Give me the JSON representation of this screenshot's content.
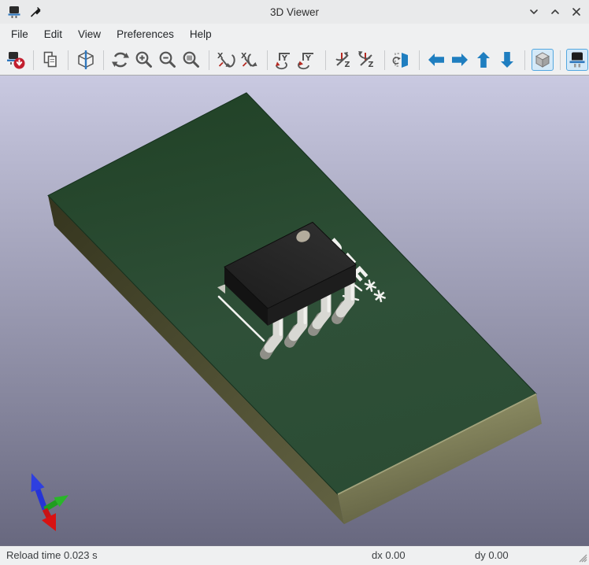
{
  "window": {
    "title": "3D Viewer",
    "controls": [
      "shade",
      "maximize",
      "close"
    ]
  },
  "menubar": {
    "items": [
      "File",
      "Edit",
      "View",
      "Preferences",
      "Help"
    ]
  },
  "toolbar": {
    "groups": [
      [
        "reload-board"
      ],
      [
        "copy-image"
      ],
      [
        "raytracing"
      ],
      [
        "redraw",
        "zoom-in",
        "zoom-out",
        "zoom-fit"
      ],
      [
        "rotate-x-cw",
        "rotate-x-ccw"
      ],
      [
        "rotate-y-cw",
        "rotate-y-ccw"
      ],
      [
        "rotate-z-cw",
        "rotate-z-ccw"
      ],
      [
        "flip-board"
      ],
      [
        "move-left",
        "move-right",
        "move-up",
        "move-down"
      ],
      [
        "orthographic-projection"
      ],
      [
        "show-3d-models"
      ]
    ],
    "active_toggles": [
      "orthographic-projection",
      "show-3d-models"
    ],
    "accent_blue": "#1f7ec0",
    "icon_gray": "#555555",
    "icon_red": "#b52a22"
  },
  "viewport": {
    "silkscreen_ref": "REF**",
    "background_top": "#c9c9e1",
    "background_bottom": "#68687f",
    "board_top_color": "#2b4c35",
    "board_side_color": "#72724e",
    "chip_color": "#232323",
    "axis_colors": {
      "x": "#d81212",
      "y": "#2ab62a",
      "z": "#2e3fe0"
    }
  },
  "statusbar": {
    "reload_time": "Reload time 0.023 s",
    "dx": "dx 0.00",
    "dy": "dy 0.00"
  }
}
